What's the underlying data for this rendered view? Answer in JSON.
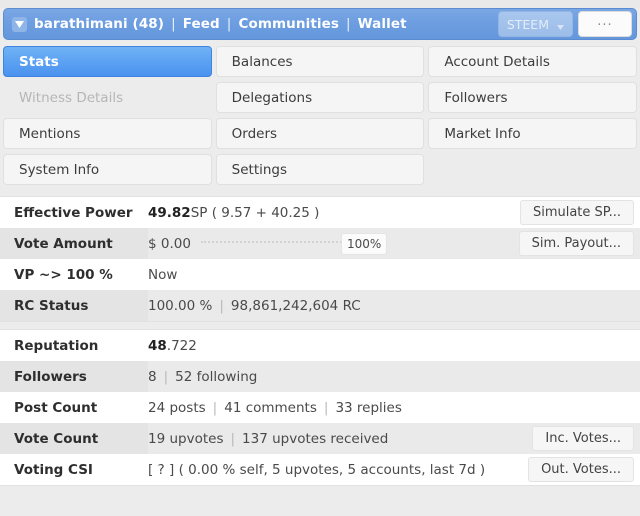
{
  "header": {
    "user_caret_icon": "chevron-down-icon",
    "username": "barathimani (48)",
    "separator": "|",
    "links": [
      "Feed",
      "Communities",
      "Wallet"
    ],
    "token_selector": {
      "label": "STEEM",
      "caret_icon": "caret-down-icon"
    },
    "more_button_label": "...",
    "accent_color": "#6c9de0"
  },
  "tabs": [
    {
      "label": "Stats",
      "state": "active"
    },
    {
      "label": "Balances",
      "state": "normal"
    },
    {
      "label": "Account Details",
      "state": "normal"
    },
    {
      "label": "Witness Details",
      "state": "disabled"
    },
    {
      "label": "Delegations",
      "state": "normal"
    },
    {
      "label": "Followers",
      "state": "normal"
    },
    {
      "label": "Mentions",
      "state": "normal"
    },
    {
      "label": "Orders",
      "state": "normal"
    },
    {
      "label": "Market Info",
      "state": "normal"
    },
    {
      "label": "System Info",
      "state": "normal"
    },
    {
      "label": "Settings",
      "state": "normal"
    },
    {
      "label": "",
      "state": "empty"
    }
  ],
  "stats_group_1": [
    {
      "label": "Effective Power",
      "value_strong": "49.82",
      "value_rest": " SP ( 9.57 + 40.25 )",
      "action": "Simulate SP..."
    },
    {
      "label": "Vote Amount",
      "value_strong": "",
      "value_rest": "$ 0.00",
      "slider_percent": "100%",
      "action": "Sim. Payout..."
    },
    {
      "label": "VP ~> 100 %",
      "value_strong": "",
      "value_rest": "Now",
      "action": ""
    },
    {
      "label": "RC Status",
      "value_strong": "",
      "value_rest": "100.00 %",
      "value_extra": "98,861,242,604 RC",
      "action": ""
    }
  ],
  "stats_group_2": [
    {
      "label": "Reputation",
      "value_strong": "48",
      "value_rest": ".722",
      "action": ""
    },
    {
      "label": "Followers",
      "value_strong": "",
      "value_rest": "8",
      "value_extra": "52 following",
      "action": ""
    },
    {
      "label": "Post Count",
      "value_strong": "",
      "value_rest": "24 posts",
      "value_extra": "41 comments",
      "value_extra2": "33 replies",
      "action": ""
    },
    {
      "label": "Vote Count",
      "value_strong": "",
      "value_rest": "19 upvotes",
      "value_extra": "137 upvotes received",
      "action": "Inc. Votes..."
    },
    {
      "label": "Voting CSI",
      "value_strong": "",
      "value_rest": "[ ? ] ( 0.00 % self, 5 upvotes, 5 accounts, last 7d )",
      "action": "Out. Votes..."
    }
  ]
}
